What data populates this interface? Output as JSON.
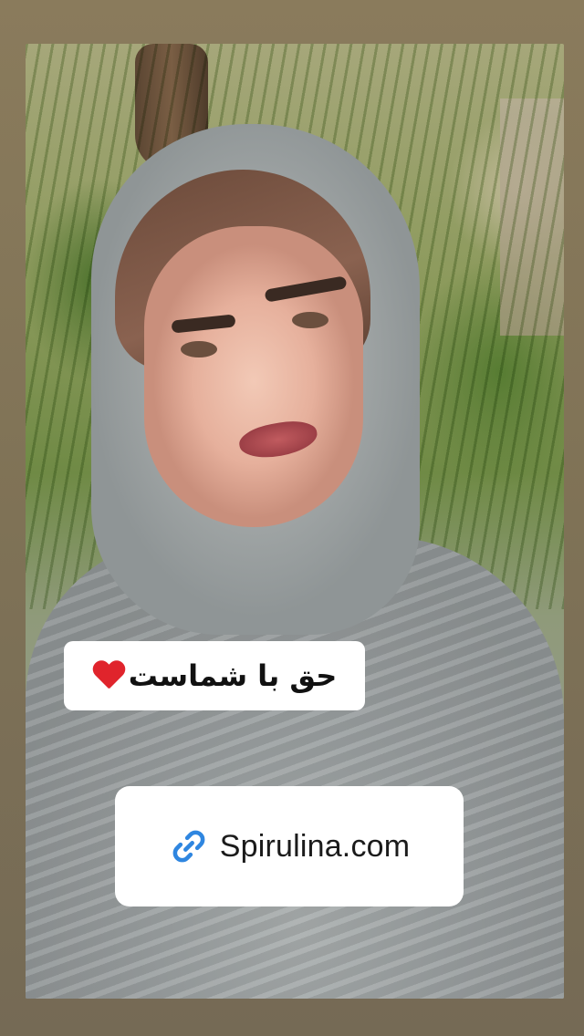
{
  "story": {
    "text_sticker": {
      "text": "حق با شماست",
      "emoji": "heart-emoji"
    },
    "link_sticker": {
      "label": "Spirulina.com",
      "icon": "link-icon",
      "icon_color": "#2f86e0"
    }
  },
  "colors": {
    "frame_background": "#84765a",
    "sticker_background": "#ffffff",
    "heart": "#e0242c"
  }
}
